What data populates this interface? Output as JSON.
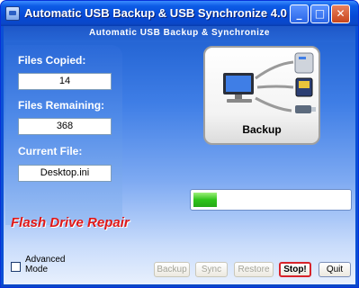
{
  "window": {
    "title": "Automatic USB Backup & USB Synchronize 4.0",
    "controls": {
      "minimize": "_",
      "maximize": "□",
      "close": "✕"
    }
  },
  "header": {
    "title": "Automatic USB Backup & Synchronize"
  },
  "stats": {
    "files_copied_label": "Files Copied:",
    "files_copied_value": "14",
    "files_remaining_label": "Files Remaining:",
    "files_remaining_value": "368",
    "current_file_label": "Current File:",
    "current_file_value": "Desktop.ini"
  },
  "backup_tile": {
    "label": "Backup",
    "icons": [
      "computer-icon",
      "external-drive-icon",
      "memory-card-icon",
      "usb-stick-icon"
    ]
  },
  "progress": {
    "fraction": 0.15
  },
  "promo_text": "Flash Drive Repair",
  "advanced_mode": {
    "label_line1": "Advanced",
    "label_line2": "Mode",
    "checked": false
  },
  "buttons": {
    "backup": "Backup",
    "sync": "Sync",
    "restore": "Restore",
    "stop": "Stop!",
    "quit": "Quit"
  },
  "colors": {
    "title_bar": "#0a4fd6",
    "promo": "#e01818",
    "progress": "#2fc41a",
    "stop_border": "#d8232a"
  }
}
